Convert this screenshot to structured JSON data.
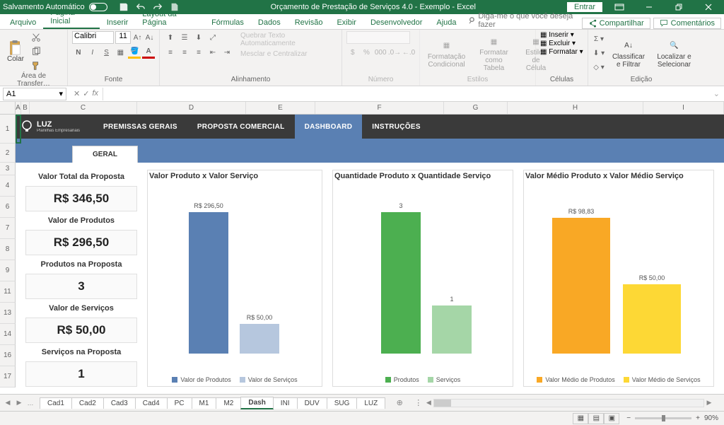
{
  "titlebar": {
    "autosave": "Salvamento Automático",
    "title": "Orçamento de Prestação de Serviços 4.0 - Exemplo  -  Excel",
    "entrar": "Entrar"
  },
  "menu": {
    "arquivo": "Arquivo",
    "pagina_inicial": "Página Inicial",
    "inserir": "Inserir",
    "layout": "Layout da Página",
    "formulas": "Fórmulas",
    "dados": "Dados",
    "revisao": "Revisão",
    "exibir": "Exibir",
    "desenvolvedor": "Desenvolvedor",
    "ajuda": "Ajuda",
    "search": "Diga-me o que você deseja fazer",
    "compartilhar": "Compartilhar",
    "comentarios": "Comentários"
  },
  "ribbon": {
    "colar": "Colar",
    "clipboard_label": "Área de Transfer…",
    "font_name": "Calibri",
    "font_size": "11",
    "fonte_label": "Fonte",
    "alinhamento_label": "Alinhamento",
    "quebrar": "Quebrar Texto Automaticamente",
    "mesclar": "Mesclar e Centralizar",
    "numero_label": "Número",
    "formatacao_cond": "Formatação Condicional",
    "formatar_tabela": "Formatar como Tabela",
    "estilos_celula": "Estilos de Célula",
    "estilos_label": "Estilos",
    "inserir_cell": "Inserir",
    "excluir_cell": "Excluir",
    "formatar_cell": "Formatar",
    "celulas_label": "Células",
    "classificar": "Classificar e Filtrar",
    "localizar": "Localizar e Selecionar",
    "edicao_label": "Edição"
  },
  "namebox": "A1",
  "columns": [
    "A",
    "B",
    "C",
    "D",
    "E",
    "F",
    "G",
    "H",
    "I"
  ],
  "rows": [
    "1",
    "2",
    "3",
    "4",
    "6",
    "7",
    "8",
    "9",
    "11",
    "13",
    "14",
    "16",
    "17"
  ],
  "logo": {
    "brand": "LUZ",
    "tagline": "Planilhas Empresariais"
  },
  "nav": {
    "premissas": "PREMISSAS GERAIS",
    "proposta": "PROPOSTA COMERCIAL",
    "dashboard": "DASHBOARD",
    "instrucoes": "INSTRUÇÕES"
  },
  "subtab": "GERAL",
  "kpi": {
    "total_label": "Valor Total da Proposta",
    "total_value": "R$ 346,50",
    "produtos_label": "Valor de Produtos",
    "produtos_value": "R$ 296,50",
    "prod_count_label": "Produtos na Proposta",
    "prod_count_value": "3",
    "servicos_label": "Valor de Serviços",
    "servicos_value": "R$ 50,00",
    "serv_count_label": "Serviços na Proposta",
    "serv_count_value": "1"
  },
  "chart1": {
    "title": "Valor Produto x Valor Serviço",
    "v1_label": "R$ 296,50",
    "v2_label": "R$ 50,00",
    "legend1": "Valor de Produtos",
    "legend2": "Valor de Serviços"
  },
  "chart2": {
    "title": "Quantidade Produto x Quantidade Serviço",
    "v1_label": "3",
    "v2_label": "1",
    "legend1": "Produtos",
    "legend2": "Serviços"
  },
  "chart3": {
    "title": "Valor Médio Produto x Valor Médio Serviço",
    "v1_label": "R$ 98,83",
    "v2_label": "R$ 50,00",
    "legend1": "Valor Médio de Produtos",
    "legend2": "Valor Médio de Serviços"
  },
  "chart_data": [
    {
      "type": "bar",
      "title": "Valor Produto x Valor Serviço",
      "categories": [
        "Valor de Produtos",
        "Valor de Serviços"
      ],
      "values": [
        296.5,
        50.0
      ],
      "ylabel": "R$",
      "ylim": [
        0,
        300
      ]
    },
    {
      "type": "bar",
      "title": "Quantidade Produto x Quantidade Serviço",
      "categories": [
        "Produtos",
        "Serviços"
      ],
      "values": [
        3,
        1
      ],
      "ylim": [
        0,
        3
      ]
    },
    {
      "type": "bar",
      "title": "Valor Médio Produto x Valor Médio Serviço",
      "categories": [
        "Valor Médio de Produtos",
        "Valor Médio de Serviços"
      ],
      "values": [
        98.83,
        50.0
      ],
      "ylabel": "R$",
      "ylim": [
        0,
        100
      ]
    }
  ],
  "tabs": [
    "Cad1",
    "Cad2",
    "Cad3",
    "Cad4",
    "PC",
    "M1",
    "M2",
    "Dash",
    "INI",
    "DUV",
    "SUG",
    "LUZ"
  ],
  "status": {
    "ready": "",
    "zoom": "90%"
  }
}
